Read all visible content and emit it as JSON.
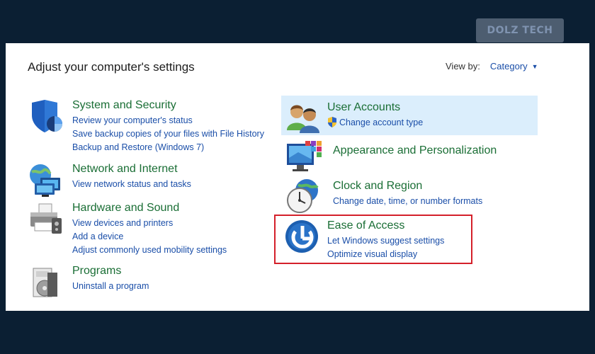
{
  "watermark": "DOLZ TECH",
  "heading": "Adjust your computer's settings",
  "view_by": {
    "label": "View by:",
    "value": "Category"
  },
  "left_categories": [
    {
      "title": "System and Security",
      "links": [
        "Review your computer's status",
        "Save backup copies of your files with File History",
        "Backup and Restore (Windows 7)"
      ],
      "icon": "shield-icon"
    },
    {
      "title": "Network and Internet",
      "links": [
        "View network status and tasks"
      ],
      "icon": "network-globe-icon"
    },
    {
      "title": "Hardware and Sound",
      "links": [
        "View devices and printers",
        "Add a device",
        "Adjust commonly used mobility settings"
      ],
      "icon": "printer-icon"
    },
    {
      "title": "Programs",
      "links": [
        "Uninstall a program"
      ],
      "icon": "programs-disc-icon"
    }
  ],
  "right_categories": [
    {
      "title": "User Accounts",
      "links": [
        "Change account type"
      ],
      "icon": "users-icon",
      "highlighted": true
    },
    {
      "title": "Appearance and Personalization",
      "links": [],
      "icon": "monitor-palette-icon"
    },
    {
      "title": "Clock and Region",
      "links": [
        "Change date, time, or number formats"
      ],
      "icon": "clock-globe-icon"
    },
    {
      "title": "Ease of Access",
      "links": [
        "Let Windows suggest settings",
        "Optimize visual display"
      ],
      "icon": "ease-of-access-icon",
      "outlined_color": "#d4202a"
    }
  ]
}
